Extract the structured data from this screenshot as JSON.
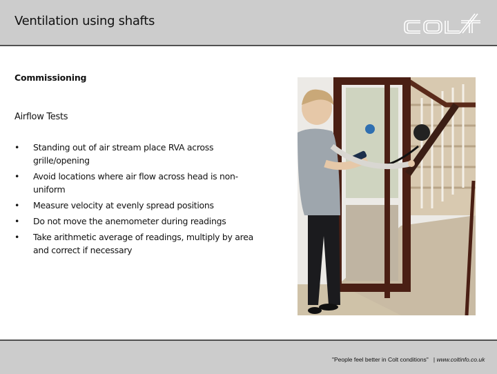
{
  "header": {
    "title": "Ventilation using shafts",
    "logo_text": "COLT",
    "logo_icon": "colt-logo-icon",
    "colors": {
      "band": "#cccccc",
      "rule": "#505050",
      "logo": "#ffffff"
    }
  },
  "content": {
    "subtitle": "Commissioning",
    "section_title": "Airflow Tests",
    "bullet_glyph": "•",
    "bullets": [
      {
        "text": "Standing out of air stream place RVA across grille/opening"
      },
      {
        "text": "Avoid locations where air flow across head is non-uniform"
      },
      {
        "text": "Measure velocity at evenly spread positions"
      },
      {
        "text": "Do not move the anemometer during readings"
      },
      {
        "text": "Take arithmetic average of readings, multiply by area and correct if necessary"
      }
    ]
  },
  "photo": {
    "description": "Man in grey sweater vest holding an anemometer with a hood against a doorway by a staircase"
  },
  "footer": {
    "slogan": "\"People feel better in Colt conditions\"",
    "separator": "|",
    "url": "www.coltinfo.co.uk"
  }
}
